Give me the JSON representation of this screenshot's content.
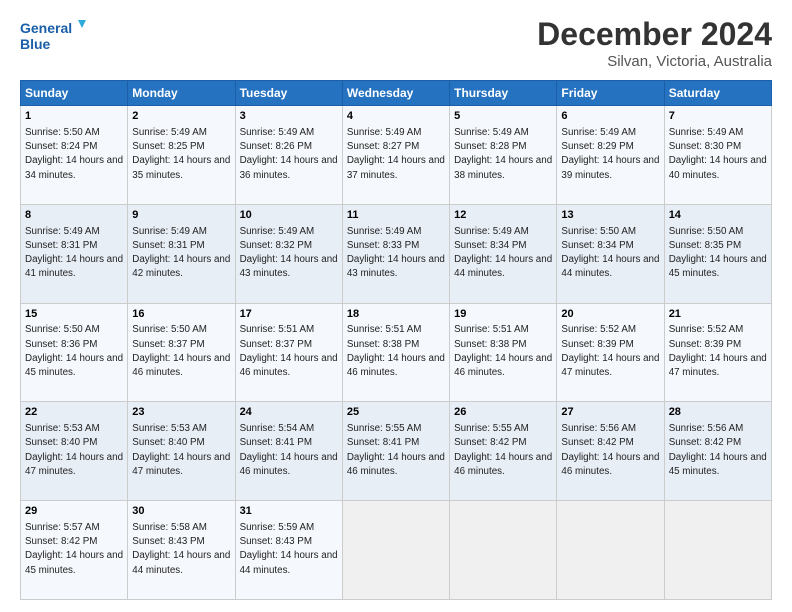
{
  "header": {
    "logo_line1": "General",
    "logo_line2": "Blue",
    "month": "December 2024",
    "location": "Silvan, Victoria, Australia"
  },
  "weekdays": [
    "Sunday",
    "Monday",
    "Tuesday",
    "Wednesday",
    "Thursday",
    "Friday",
    "Saturday"
  ],
  "weeks": [
    [
      {
        "day": "1",
        "sunrise": "Sunrise: 5:50 AM",
        "sunset": "Sunset: 8:24 PM",
        "daylight": "Daylight: 14 hours and 34 minutes."
      },
      {
        "day": "2",
        "sunrise": "Sunrise: 5:49 AM",
        "sunset": "Sunset: 8:25 PM",
        "daylight": "Daylight: 14 hours and 35 minutes."
      },
      {
        "day": "3",
        "sunrise": "Sunrise: 5:49 AM",
        "sunset": "Sunset: 8:26 PM",
        "daylight": "Daylight: 14 hours and 36 minutes."
      },
      {
        "day": "4",
        "sunrise": "Sunrise: 5:49 AM",
        "sunset": "Sunset: 8:27 PM",
        "daylight": "Daylight: 14 hours and 37 minutes."
      },
      {
        "day": "5",
        "sunrise": "Sunrise: 5:49 AM",
        "sunset": "Sunset: 8:28 PM",
        "daylight": "Daylight: 14 hours and 38 minutes."
      },
      {
        "day": "6",
        "sunrise": "Sunrise: 5:49 AM",
        "sunset": "Sunset: 8:29 PM",
        "daylight": "Daylight: 14 hours and 39 minutes."
      },
      {
        "day": "7",
        "sunrise": "Sunrise: 5:49 AM",
        "sunset": "Sunset: 8:30 PM",
        "daylight": "Daylight: 14 hours and 40 minutes."
      }
    ],
    [
      {
        "day": "8",
        "sunrise": "Sunrise: 5:49 AM",
        "sunset": "Sunset: 8:31 PM",
        "daylight": "Daylight: 14 hours and 41 minutes."
      },
      {
        "day": "9",
        "sunrise": "Sunrise: 5:49 AM",
        "sunset": "Sunset: 8:31 PM",
        "daylight": "Daylight: 14 hours and 42 minutes."
      },
      {
        "day": "10",
        "sunrise": "Sunrise: 5:49 AM",
        "sunset": "Sunset: 8:32 PM",
        "daylight": "Daylight: 14 hours and 43 minutes."
      },
      {
        "day": "11",
        "sunrise": "Sunrise: 5:49 AM",
        "sunset": "Sunset: 8:33 PM",
        "daylight": "Daylight: 14 hours and 43 minutes."
      },
      {
        "day": "12",
        "sunrise": "Sunrise: 5:49 AM",
        "sunset": "Sunset: 8:34 PM",
        "daylight": "Daylight: 14 hours and 44 minutes."
      },
      {
        "day": "13",
        "sunrise": "Sunrise: 5:50 AM",
        "sunset": "Sunset: 8:34 PM",
        "daylight": "Daylight: 14 hours and 44 minutes."
      },
      {
        "day": "14",
        "sunrise": "Sunrise: 5:50 AM",
        "sunset": "Sunset: 8:35 PM",
        "daylight": "Daylight: 14 hours and 45 minutes."
      }
    ],
    [
      {
        "day": "15",
        "sunrise": "Sunrise: 5:50 AM",
        "sunset": "Sunset: 8:36 PM",
        "daylight": "Daylight: 14 hours and 45 minutes."
      },
      {
        "day": "16",
        "sunrise": "Sunrise: 5:50 AM",
        "sunset": "Sunset: 8:37 PM",
        "daylight": "Daylight: 14 hours and 46 minutes."
      },
      {
        "day": "17",
        "sunrise": "Sunrise: 5:51 AM",
        "sunset": "Sunset: 8:37 PM",
        "daylight": "Daylight: 14 hours and 46 minutes."
      },
      {
        "day": "18",
        "sunrise": "Sunrise: 5:51 AM",
        "sunset": "Sunset: 8:38 PM",
        "daylight": "Daylight: 14 hours and 46 minutes."
      },
      {
        "day": "19",
        "sunrise": "Sunrise: 5:51 AM",
        "sunset": "Sunset: 8:38 PM",
        "daylight": "Daylight: 14 hours and 46 minutes."
      },
      {
        "day": "20",
        "sunrise": "Sunrise: 5:52 AM",
        "sunset": "Sunset: 8:39 PM",
        "daylight": "Daylight: 14 hours and 47 minutes."
      },
      {
        "day": "21",
        "sunrise": "Sunrise: 5:52 AM",
        "sunset": "Sunset: 8:39 PM",
        "daylight": "Daylight: 14 hours and 47 minutes."
      }
    ],
    [
      {
        "day": "22",
        "sunrise": "Sunrise: 5:53 AM",
        "sunset": "Sunset: 8:40 PM",
        "daylight": "Daylight: 14 hours and 47 minutes."
      },
      {
        "day": "23",
        "sunrise": "Sunrise: 5:53 AM",
        "sunset": "Sunset: 8:40 PM",
        "daylight": "Daylight: 14 hours and 47 minutes."
      },
      {
        "day": "24",
        "sunrise": "Sunrise: 5:54 AM",
        "sunset": "Sunset: 8:41 PM",
        "daylight": "Daylight: 14 hours and 46 minutes."
      },
      {
        "day": "25",
        "sunrise": "Sunrise: 5:55 AM",
        "sunset": "Sunset: 8:41 PM",
        "daylight": "Daylight: 14 hours and 46 minutes."
      },
      {
        "day": "26",
        "sunrise": "Sunrise: 5:55 AM",
        "sunset": "Sunset: 8:42 PM",
        "daylight": "Daylight: 14 hours and 46 minutes."
      },
      {
        "day": "27",
        "sunrise": "Sunrise: 5:56 AM",
        "sunset": "Sunset: 8:42 PM",
        "daylight": "Daylight: 14 hours and 46 minutes."
      },
      {
        "day": "28",
        "sunrise": "Sunrise: 5:56 AM",
        "sunset": "Sunset: 8:42 PM",
        "daylight": "Daylight: 14 hours and 45 minutes."
      }
    ],
    [
      {
        "day": "29",
        "sunrise": "Sunrise: 5:57 AM",
        "sunset": "Sunset: 8:42 PM",
        "daylight": "Daylight: 14 hours and 45 minutes."
      },
      {
        "day": "30",
        "sunrise": "Sunrise: 5:58 AM",
        "sunset": "Sunset: 8:43 PM",
        "daylight": "Daylight: 14 hours and 44 minutes."
      },
      {
        "day": "31",
        "sunrise": "Sunrise: 5:59 AM",
        "sunset": "Sunset: 8:43 PM",
        "daylight": "Daylight: 14 hours and 44 minutes."
      },
      null,
      null,
      null,
      null
    ]
  ]
}
